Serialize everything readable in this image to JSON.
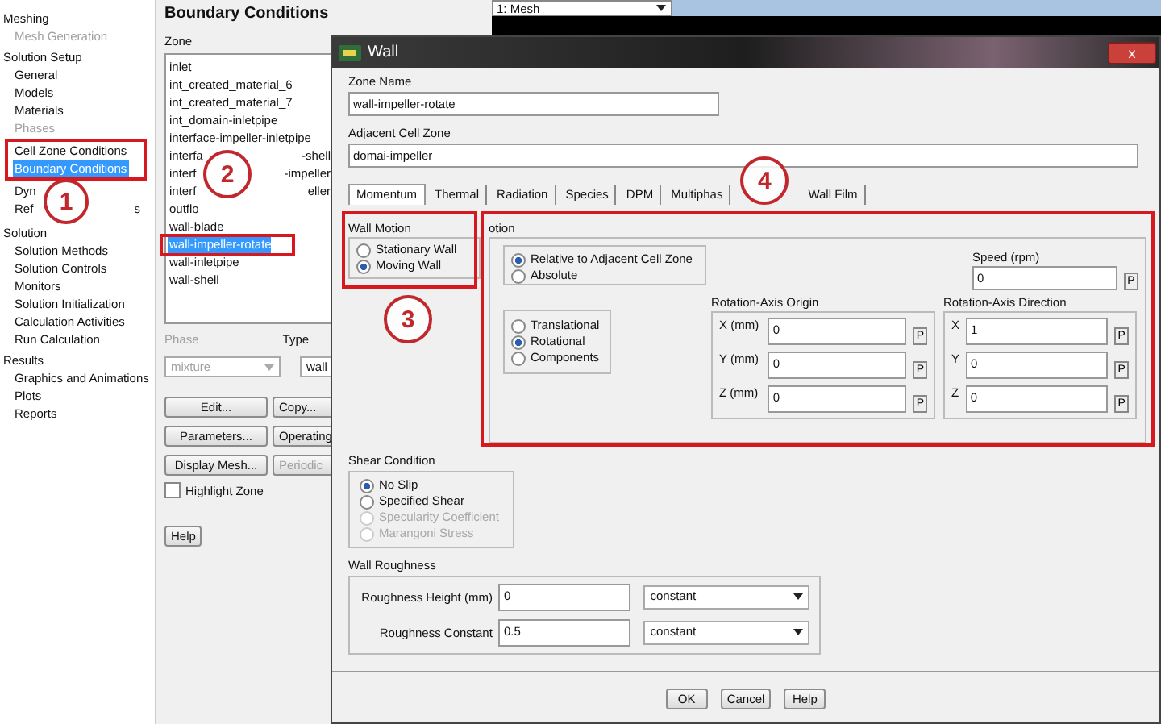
{
  "tree": {
    "items": [
      {
        "label": "Meshing",
        "selected": false,
        "disabled": false,
        "children": [
          {
            "label": "Mesh Generation",
            "selected": false,
            "disabled": true
          }
        ]
      },
      {
        "label": "Solution Setup",
        "selected": false,
        "disabled": false,
        "children": [
          {
            "label": "General",
            "selected": false,
            "disabled": false
          },
          {
            "label": "Models",
            "selected": false,
            "disabled": false
          },
          {
            "label": "Materials",
            "selected": false,
            "disabled": false
          },
          {
            "label": "Phases",
            "selected": false,
            "disabled": true
          },
          {
            "label": "Cell Zone Conditions",
            "selected": false,
            "disabled": false
          },
          {
            "label": "Boundary Conditions",
            "selected": true,
            "disabled": false
          },
          {
            "label": "Dyn",
            "selected": false,
            "disabled": false
          },
          {
            "label": "Ref",
            "tail": "s",
            "selected": false,
            "disabled": false
          }
        ]
      },
      {
        "label": "Solution",
        "selected": false,
        "disabled": false,
        "children": [
          {
            "label": "Solution Methods",
            "selected": false,
            "disabled": false
          },
          {
            "label": "Solution Controls",
            "selected": false,
            "disabled": false
          },
          {
            "label": "Monitors",
            "selected": false,
            "disabled": false
          },
          {
            "label": "Solution Initialization",
            "selected": false,
            "disabled": false
          },
          {
            "label": "Calculation Activities",
            "selected": false,
            "disabled": false
          },
          {
            "label": "Run Calculation",
            "selected": false,
            "disabled": false
          }
        ]
      },
      {
        "label": "Results",
        "selected": false,
        "disabled": false,
        "children": [
          {
            "label": "Graphics and Animations",
            "selected": false,
            "disabled": false
          },
          {
            "label": "Plots",
            "selected": false,
            "disabled": false
          },
          {
            "label": "Reports",
            "selected": false,
            "disabled": false
          }
        ]
      }
    ]
  },
  "boundary_panel": {
    "title": "Boundary Conditions",
    "zone_label": "Zone",
    "zones": [
      {
        "label": "inlet",
        "selected": false
      },
      {
        "label": "int_created_material_6",
        "selected": false
      },
      {
        "label": "int_created_material_7",
        "selected": false
      },
      {
        "label": "int_domain-inletpipe",
        "selected": false
      },
      {
        "label": "interface-impeller-inletpipe",
        "selected": false
      },
      {
        "label": "interfa",
        "tail": "-shell",
        "selected": false
      },
      {
        "label": "interf",
        "tail": "-impeller",
        "selected": false
      },
      {
        "label": "interf",
        "tail": "eller",
        "selected": false
      },
      {
        "label": "outflo",
        "selected": false
      },
      {
        "label": "wall-blade",
        "selected": false
      },
      {
        "label": "wall-impeller-rotate",
        "selected": true
      },
      {
        "label": "wall-inletpipe",
        "selected": false
      },
      {
        "label": "wall-shell",
        "selected": false
      }
    ],
    "phase": {
      "label": "Phase",
      "value": "mixture",
      "disabled": true
    },
    "type": {
      "label": "Type",
      "value": "wall"
    },
    "buttons": [
      {
        "label": "Edit...",
        "disabled": false
      },
      {
        "label": "Copy...",
        "disabled": false
      },
      {
        "label": "Parameters...",
        "disabled": false
      },
      {
        "label": "Operating",
        "disabled": false
      },
      {
        "label": "Display Mesh...",
        "disabled": false
      },
      {
        "label": "Periodic",
        "disabled": true
      }
    ],
    "highlight_zone": {
      "label": "Highlight Zone",
      "checked": false
    },
    "help": "Help"
  },
  "graphics": {
    "view_select": "1: Mesh"
  },
  "dialog": {
    "title": "Wall",
    "close": "x",
    "zone_name": {
      "label": "Zone Name",
      "value": "wall-impeller-rotate"
    },
    "adjacent_cell_zone": {
      "label": "Adjacent Cell Zone",
      "value": "domai-impeller"
    },
    "tabs": [
      {
        "label": "Momentum",
        "selected": true
      },
      {
        "label": "Thermal",
        "selected": false
      },
      {
        "label": "Radiation",
        "selected": false
      },
      {
        "label": "Species",
        "selected": false
      },
      {
        "label": "DPM",
        "selected": false
      },
      {
        "label": "Multiphas",
        "selected": false
      },
      {
        "label": "Wall Film",
        "selected": false
      }
    ],
    "wall_motion": {
      "title": "Wall Motion",
      "options": [
        {
          "label": "Stationary Wall",
          "selected": false
        },
        {
          "label": "Moving Wall",
          "selected": true
        }
      ]
    },
    "motion": {
      "title": "otion",
      "reference": [
        {
          "label": "Relative to Adjacent Cell Zone",
          "selected": true
        },
        {
          "label": "Absolute",
          "selected": false
        }
      ],
      "motion_type": [
        {
          "label": "Translational",
          "selected": false
        },
        {
          "label": "Rotational",
          "selected": true
        },
        {
          "label": "Components",
          "selected": false
        }
      ],
      "speed": {
        "label": "Speed (rpm)",
        "value": "0",
        "p": "P"
      },
      "origin": {
        "title": "Rotation-Axis Origin",
        "fields": [
          {
            "label": "X (mm)",
            "value": "0",
            "p": "P"
          },
          {
            "label": "Y (mm)",
            "value": "0",
            "p": "P"
          },
          {
            "label": "Z (mm)",
            "value": "0",
            "p": "P"
          }
        ]
      },
      "direction": {
        "title": "Rotation-Axis Direction",
        "fields": [
          {
            "label": "X",
            "value": "1",
            "p": "P"
          },
          {
            "label": "Y",
            "value": "0",
            "p": "P"
          },
          {
            "label": "Z",
            "value": "0",
            "p": "P"
          }
        ]
      }
    },
    "shear_condition": {
      "title": "Shear Condition",
      "options": [
        {
          "label": "No Slip",
          "selected": true,
          "disabled": false
        },
        {
          "label": "Specified Shear",
          "selected": false,
          "disabled": false
        },
        {
          "label": "Specularity Coefficient",
          "selected": false,
          "disabled": true
        },
        {
          "label": "Marangoni Stress",
          "selected": false,
          "disabled": true
        }
      ]
    },
    "wall_roughness": {
      "title": "Wall Roughness",
      "rows": [
        {
          "label": "Roughness Height (mm)",
          "value": "0",
          "method": "constant"
        },
        {
          "label": "Roughness Constant",
          "value": "0.5",
          "method": "constant"
        }
      ]
    },
    "buttons": [
      "OK",
      "Cancel",
      "Help"
    ]
  },
  "annotations": [
    {
      "label": "1"
    },
    {
      "label": "2"
    },
    {
      "label": "3"
    },
    {
      "label": "4"
    }
  ]
}
